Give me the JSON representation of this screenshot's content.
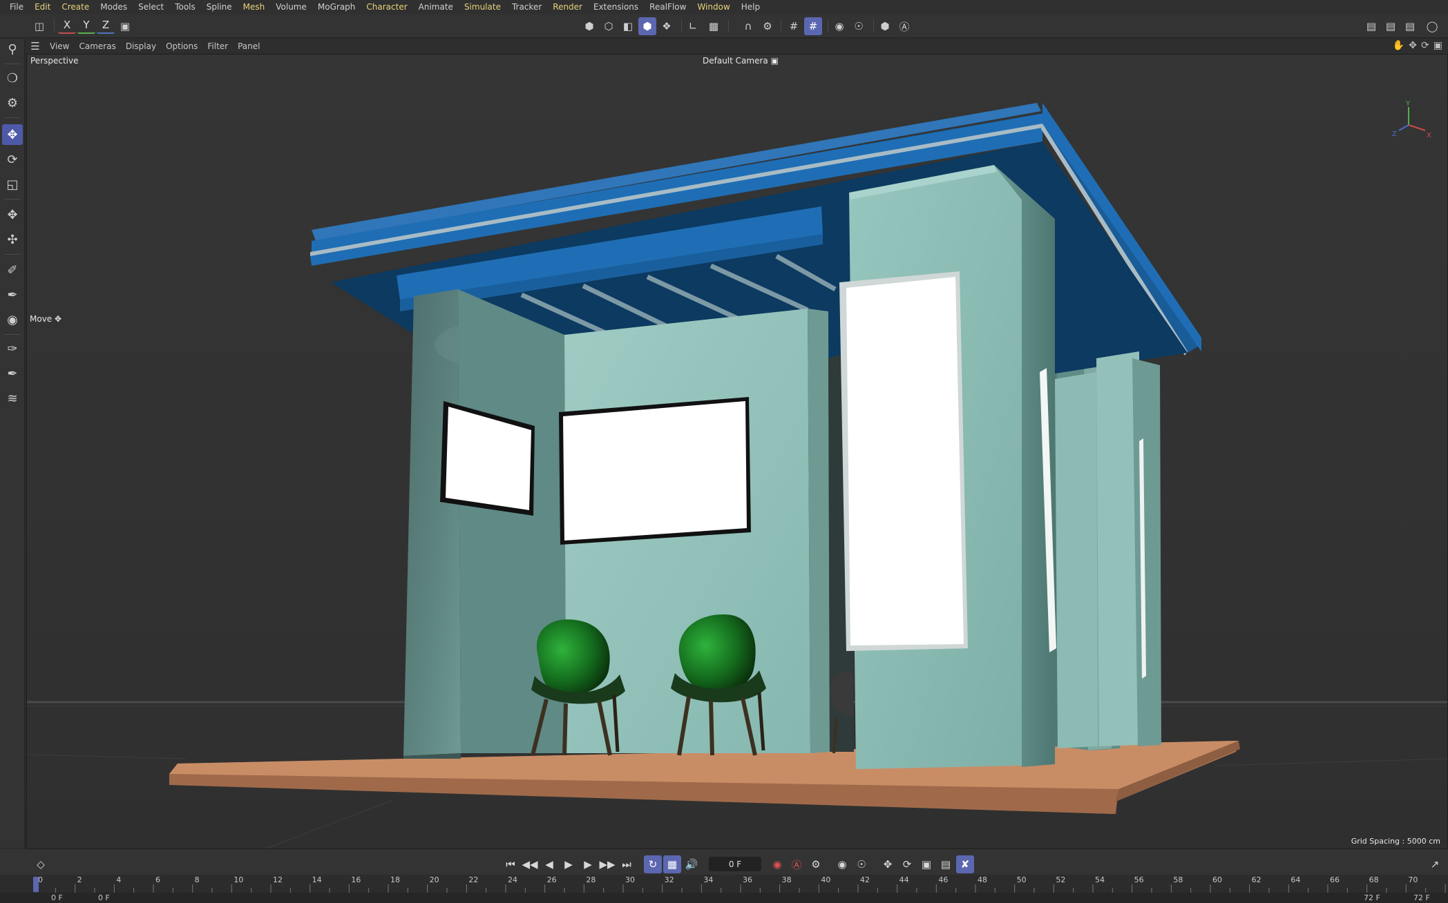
{
  "menu": [
    "File",
    "Edit",
    "Create",
    "Modes",
    "Select",
    "Tools",
    "Spline",
    "Mesh",
    "Volume",
    "MoGraph",
    "Character",
    "Animate",
    "Simulate",
    "Tracker",
    "Render",
    "Extensions",
    "RealFlow",
    "Window",
    "Help"
  ],
  "toolbar": {
    "x_label": "X",
    "y_label": "Y",
    "z_label": "Z"
  },
  "viewport_menu": [
    "View",
    "Cameras",
    "Display",
    "Options",
    "Filter",
    "Panel"
  ],
  "viewport": {
    "projection": "Perspective",
    "camera": "Default Camera",
    "tool_label": "Move",
    "grid_spacing": "Grid Spacing : 5000 cm",
    "axis_y": "Y",
    "axis_z": "Z",
    "axis_x": "X"
  },
  "transport": {
    "current_frame": "0 F"
  },
  "timeline": {
    "ticks": [
      "0",
      "2",
      "4",
      "6",
      "8",
      "10",
      "12",
      "14",
      "16",
      "18",
      "20",
      "22",
      "24",
      "26",
      "28",
      "30",
      "32",
      "34",
      "36",
      "38",
      "40",
      "42",
      "44",
      "46",
      "48",
      "50",
      "52",
      "54",
      "56",
      "58",
      "60",
      "62",
      "64",
      "66",
      "68",
      "70",
      "72"
    ],
    "start_frame": "0 F",
    "min_frame": "0 F",
    "end_frame": "72 F",
    "max_frame": "72 F"
  },
  "colors": {
    "accent_active": "#5b67b0",
    "roof_blue": "#1f6eb5",
    "wall": "#8fc1ba",
    "floor": "#c98d66",
    "chair_green": "#1c8a2a"
  }
}
